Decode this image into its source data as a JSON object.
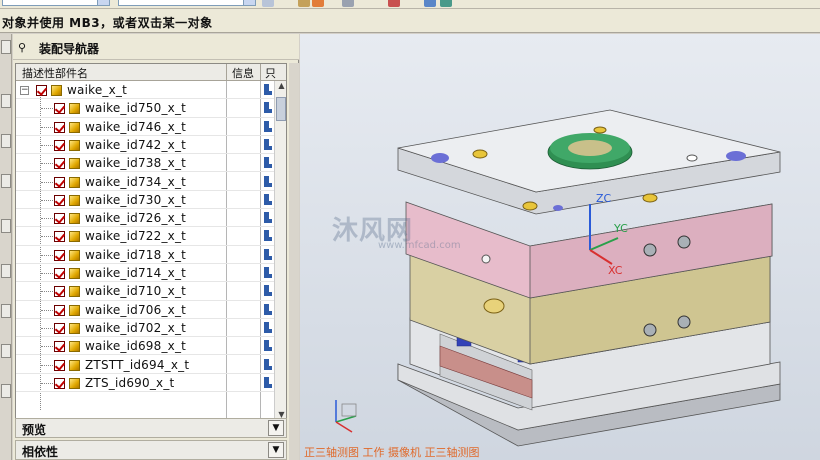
{
  "statusline": {
    "prompt": "对象并使用 MB3，或者双击某一对象"
  },
  "navigator": {
    "title": "装配导航器",
    "columns": {
      "name": "描述性部件名",
      "info": "信息",
      "readonly": "只"
    },
    "root": "waike_x_t",
    "parts": [
      "waike_id750_x_t",
      "waike_id746_x_t",
      "waike_id742_x_t",
      "waike_id738_x_t",
      "waike_id734_x_t",
      "waike_id730_x_t",
      "waike_id726_x_t",
      "waike_id722_x_t",
      "waike_id718_x_t",
      "waike_id714_x_t",
      "waike_id710_x_t",
      "waike_id706_x_t",
      "waike_id702_x_t",
      "waike_id698_x_t",
      "ZTSTT_id694_x_t",
      "ZTS_id690_x_t"
    ],
    "sections": {
      "preview": "预览",
      "dependencies": "相依性"
    }
  },
  "viewport": {
    "axis_z": "ZC",
    "axis_y": "YC",
    "axis_x": "XC",
    "watermark_brand": "沐风网",
    "watermark_url": "www.mfcad.com",
    "view_status": "正三轴测图 工作 摄像机 正三轴测图"
  },
  "colors": {
    "plate_top": "#e9ebee",
    "plate_pink": "#e4b4c3",
    "plate_yellow": "#d8cfa4",
    "ring_green": "#2f8f52",
    "marker_blue": "#6b6fd6"
  },
  "icons": [
    "pin-icon",
    "checkbox-icon",
    "part-cube-icon",
    "readonly-icon",
    "chevron-down-icon"
  ]
}
